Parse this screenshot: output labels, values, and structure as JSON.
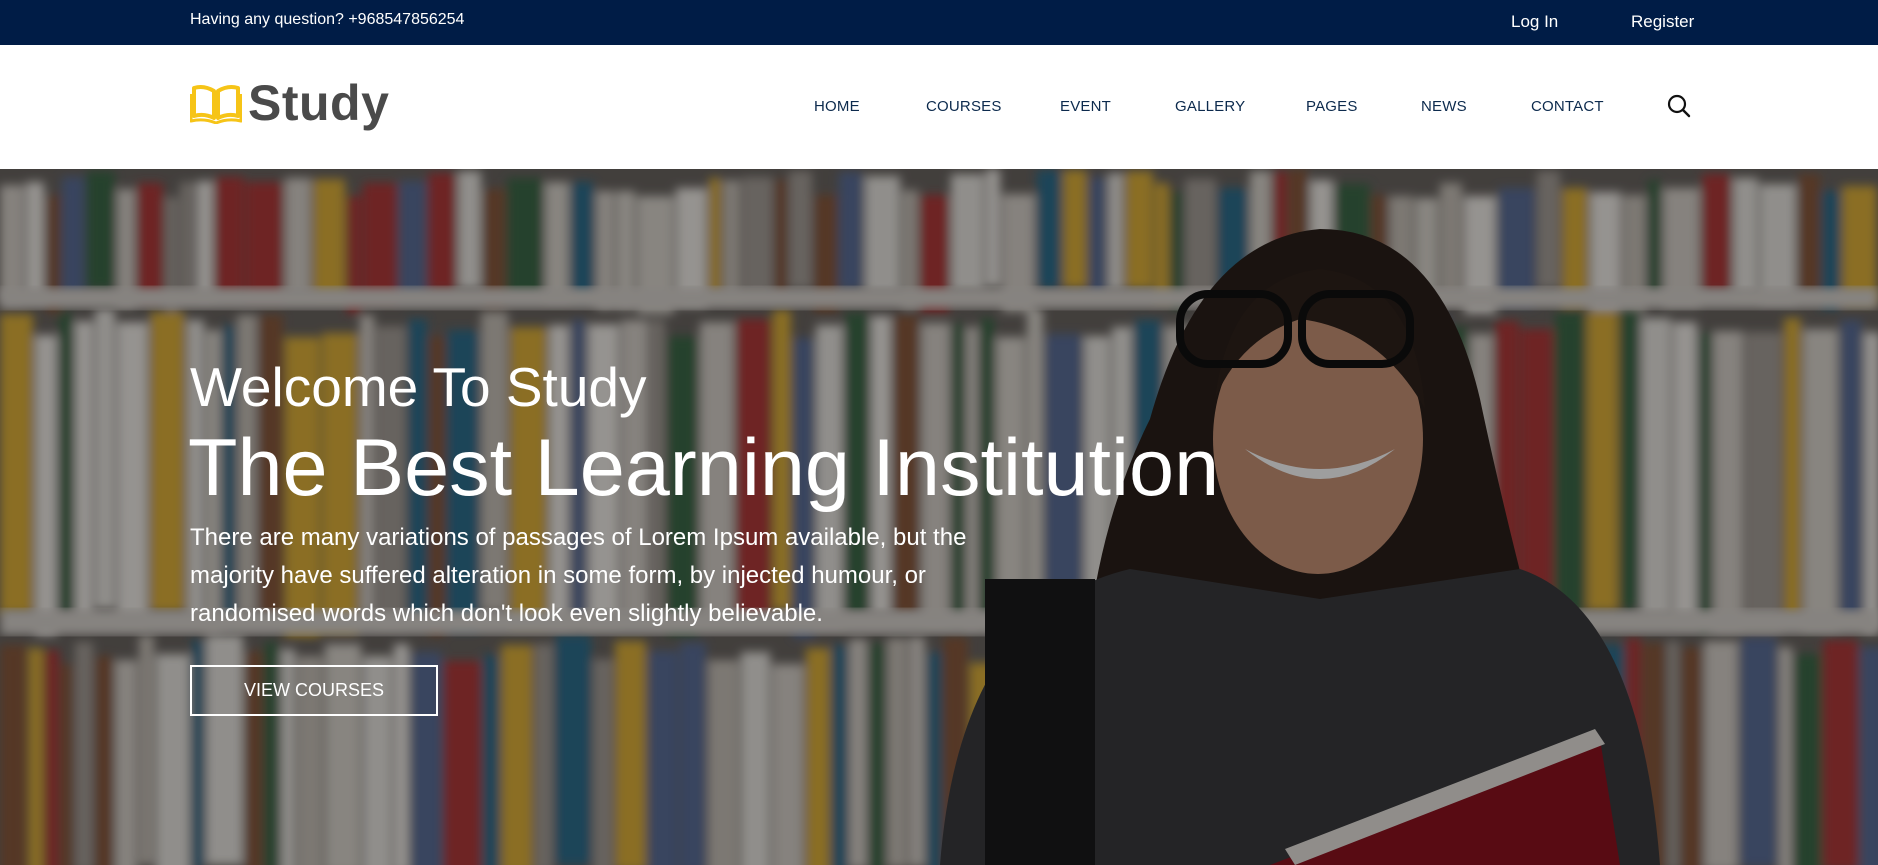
{
  "topbar": {
    "question": "Having any question? +968547856254",
    "login": "Log In",
    "register": "Register"
  },
  "header": {
    "logo_text": "Study",
    "nav": [
      {
        "label": "HOME"
      },
      {
        "label": "COURSES"
      },
      {
        "label": "EVENT"
      },
      {
        "label": "GALLERY"
      },
      {
        "label": "PAGES"
      },
      {
        "label": "NEWS"
      },
      {
        "label": "CONTACT"
      }
    ],
    "search_icon": "search-icon"
  },
  "hero": {
    "welcome": "Welcome To Study",
    "title": "The Best Learning Institution",
    "description": "There are many variations of passages of Lorem Ipsum available, but the majority have suffered alteration in some form, by injected humour, or randomised words which don't look even slightly believable.",
    "button": "VIEW COURSES"
  },
  "colors": {
    "topbar_bg": "#001c46",
    "nav_text": "#0c2a4d",
    "logo_accent": "#f6c417",
    "logo_text": "#4a4a4a",
    "hero_text": "#ffffff"
  }
}
